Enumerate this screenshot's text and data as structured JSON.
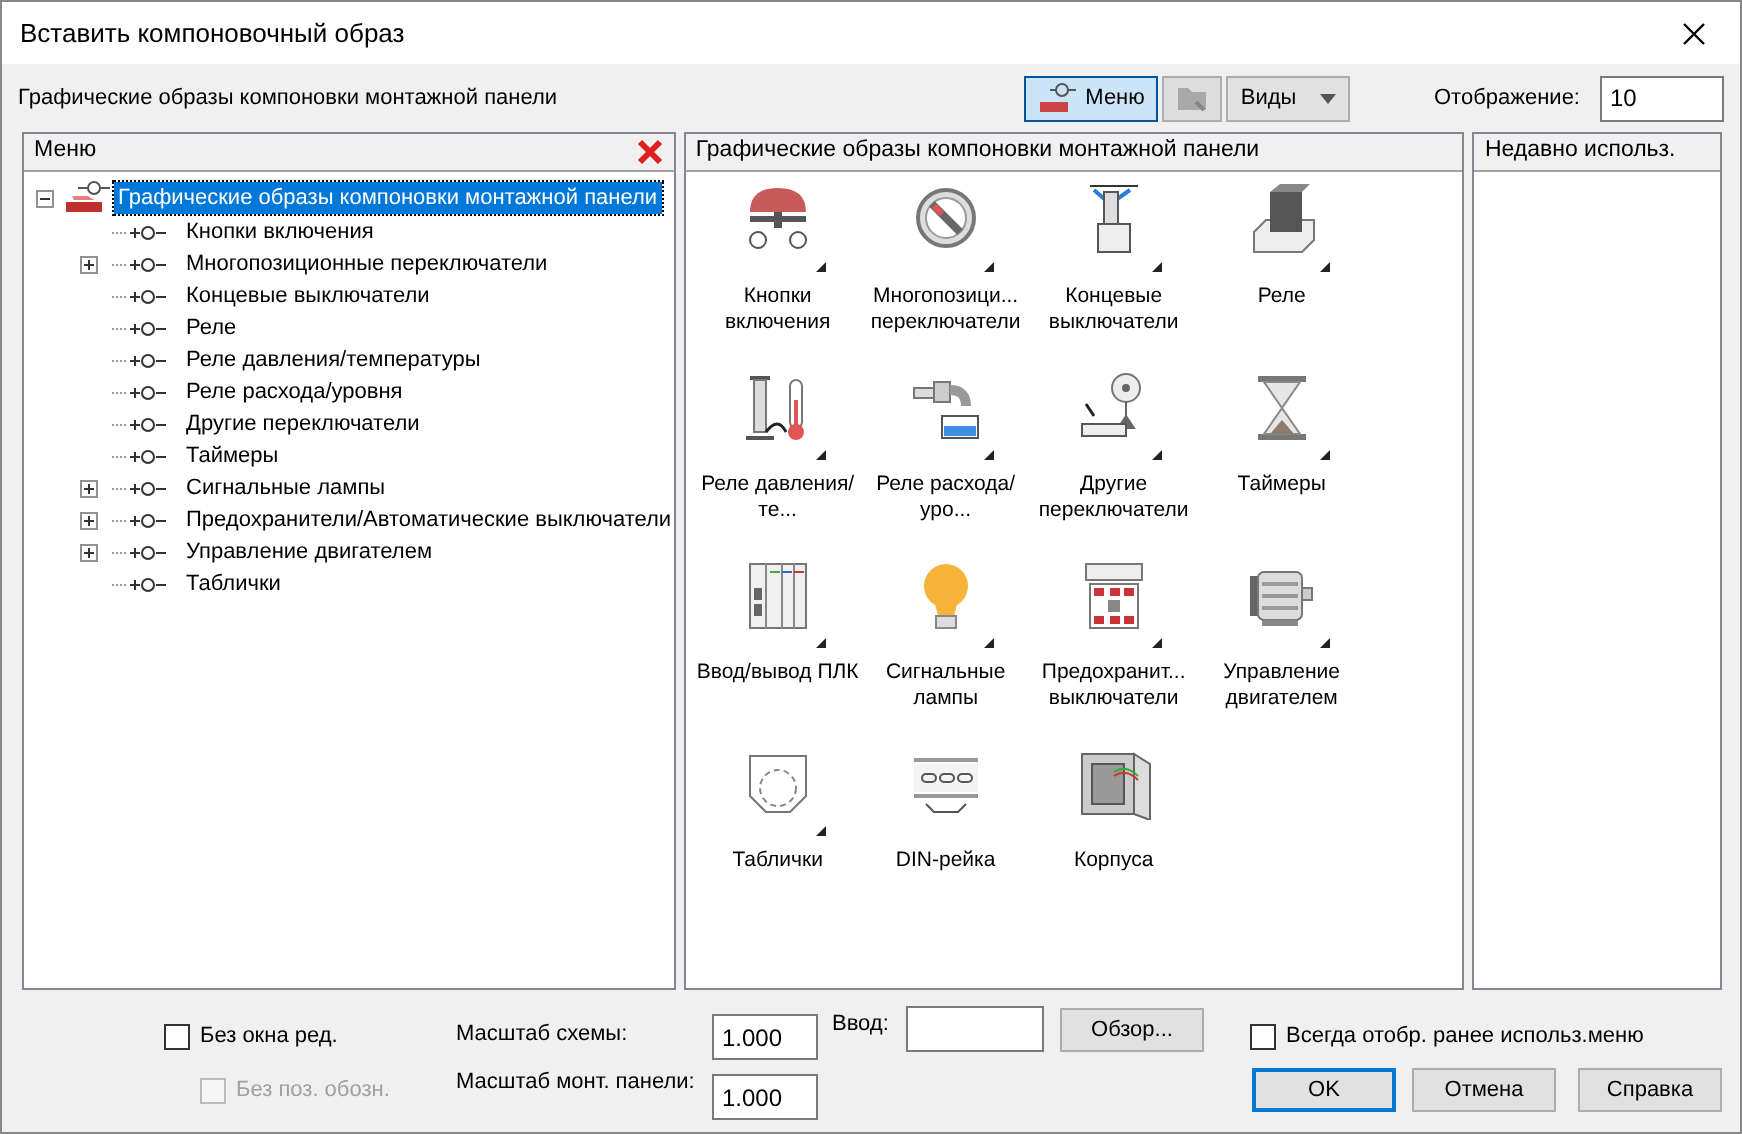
{
  "window": {
    "title": "Вставить компоновочный образ"
  },
  "toolbar": {
    "caption": "Графические образы компоновки монтажной панели",
    "menu_button": {
      "label": "Меню",
      "selected": true
    },
    "views_button": {
      "label": "Виды"
    },
    "display_label": "Отображение:",
    "display_value": "10"
  },
  "tree_panel": {
    "header": "Меню",
    "root": {
      "label": "Графические образы компоновки монтажной панели",
      "selected": true,
      "expanded": true,
      "children": [
        {
          "label": "Кнопки включения",
          "expandable": false
        },
        {
          "label": "Многопозиционные переключатели",
          "expandable": true
        },
        {
          "label": "Концевые выключатели",
          "expandable": false
        },
        {
          "label": "Реле",
          "expandable": false
        },
        {
          "label": "Реле давления/температуры",
          "expandable": false
        },
        {
          "label": "Реле расхода/уровня",
          "expandable": false
        },
        {
          "label": "Другие переключатели",
          "expandable": false
        },
        {
          "label": "Таймеры",
          "expandable": false
        },
        {
          "label": "Сигнальные лампы",
          "expandable": true
        },
        {
          "label": "Предохранители/Автоматические выключатели",
          "expandable": true
        },
        {
          "label": "Управление двигателем",
          "expandable": true
        },
        {
          "label": "Таблички",
          "expandable": false
        }
      ]
    }
  },
  "icon_panel": {
    "header": "Графические образы компоновки монтажной панели",
    "items": [
      {
        "label": "Кнопки включения",
        "submenu": true
      },
      {
        "label": "Многопозици... переключатели",
        "submenu": true
      },
      {
        "label": "Концевые выключатели",
        "submenu": true
      },
      {
        "label": "Реле",
        "submenu": true
      },
      {
        "label": "Реле давления/те...",
        "submenu": true
      },
      {
        "label": "Реле расхода/уро...",
        "submenu": true
      },
      {
        "label": "Другие переключатели",
        "submenu": true
      },
      {
        "label": "Таймеры",
        "submenu": true
      },
      {
        "label": "Ввод/вывод ПЛК",
        "submenu": true
      },
      {
        "label": "Сигнальные лампы",
        "submenu": true
      },
      {
        "label": "Предохранит... выключатели",
        "submenu": true
      },
      {
        "label": "Управление двигателем",
        "submenu": true
      },
      {
        "label": "Таблички",
        "submenu": true
      },
      {
        "label": "DIN-рейка",
        "submenu": false
      },
      {
        "label": "Корпуса",
        "submenu": false
      }
    ]
  },
  "recent_panel": {
    "header": "Недавно использ."
  },
  "footer": {
    "no_editor": {
      "label": "Без окна ред.",
      "checked": false,
      "disabled": false
    },
    "no_designation": {
      "label": "Без поз. обозн.",
      "checked": false,
      "disabled": true
    },
    "schema_scale_label": "Масштаб схемы:",
    "schema_scale": "1.000",
    "panel_scale_label": "Масштаб монт. панели:",
    "panel_scale": "1.000",
    "input_label": "Ввод:",
    "browse_button": "Обзор...",
    "always_show": {
      "label": "Всегда отобр. ранее использ.меню",
      "checked": false,
      "disabled": false
    },
    "buttons": [
      {
        "label": "OK",
        "default": true
      },
      {
        "label": "Отмена",
        "default": false
      },
      {
        "label": "Справка",
        "default": false
      }
    ]
  }
}
